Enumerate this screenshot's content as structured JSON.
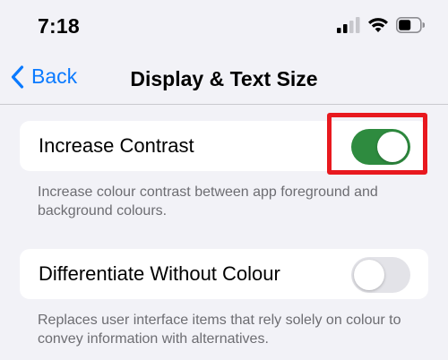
{
  "status_bar": {
    "time": "7:18",
    "icons": [
      "cellular-signal-icon",
      "wifi-icon",
      "battery-icon"
    ]
  },
  "nav": {
    "back_label": "Back",
    "title": "Display & Text Size"
  },
  "settings": [
    {
      "label": "Increase Contrast",
      "enabled": true,
      "description": "Increase colour contrast between app foreground and background colours."
    },
    {
      "label": "Differentiate Without Colour",
      "enabled": false,
      "description": "Replaces user interface items that rely solely on colour to convey information with alternatives."
    }
  ],
  "colors": {
    "accent_blue": "#0a7aff",
    "toggle_on": "#2e8b3f",
    "toggle_off": "#e3e3e8",
    "highlight": "#e8191f",
    "background": "#f2f2f7"
  }
}
